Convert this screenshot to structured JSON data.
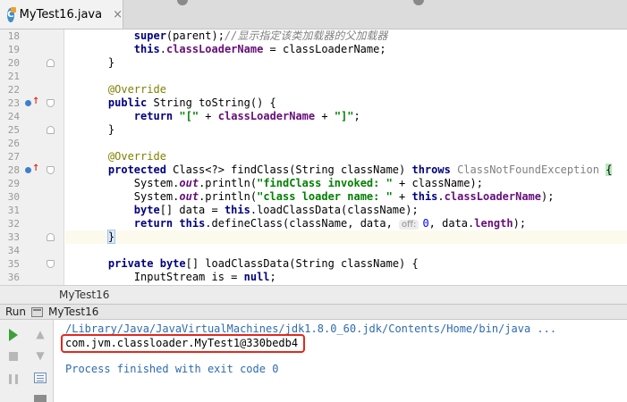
{
  "tab": {
    "icon_letter": "C",
    "file_name": "MyTest16.java",
    "close_glyph": "×"
  },
  "gutter": {
    "line_numbers": [
      "18",
      "19",
      "20",
      "21",
      "22",
      "23",
      "24",
      "25",
      "26",
      "27",
      "28",
      "29",
      "30",
      "31",
      "32",
      "33",
      "34",
      "35",
      "36"
    ]
  },
  "code": {
    "l18": {
      "kw": "super",
      "text": "(parent);",
      "comment": "//显示指定该类加载器的父加载器"
    },
    "l19": {
      "kw": "this",
      "dot": ".",
      "field": "classLoaderName",
      "text": " = classLoaderName;"
    },
    "l20": {
      "text": "}"
    },
    "l22": {
      "annotation": "@Override"
    },
    "l23": {
      "kw": "public",
      "text": " String toString() {"
    },
    "l24": {
      "kw": "return",
      "str1": "\"[\"",
      "op1": " + ",
      "field": "classLoaderName",
      "op2": " + ",
      "str2": "\"]\"",
      "end": ";"
    },
    "l25": {
      "text": "}"
    },
    "l27": {
      "annotation": "@Override"
    },
    "l28": {
      "kw1": "protected",
      "text1": " Class<?> findClass(String className) ",
      "kw2": "throws",
      "exc": " ClassNotFoundException",
      "brace": "{"
    },
    "l29": {
      "pre": "System.",
      "sfield": "out",
      "mid": ".println(",
      "str": "\"findClass invoked: \"",
      "end": " + className);"
    },
    "l30": {
      "pre": "System.",
      "sfield": "out",
      "mid": ".println(",
      "str": "\"class loader name: \"",
      "op": " + ",
      "kw": "this",
      "dot": ".",
      "field": "classLoaderName",
      "end": ");"
    },
    "l31": {
      "kw1": "byte",
      "mid": "[] data = ",
      "kw2": "this",
      "end": ".loadClassData(className);"
    },
    "l32": {
      "kw1": "return",
      "sp": " ",
      "kw2": "this",
      "mid": ".defineClass(className, data, ",
      "hint": "off:",
      "num": "0",
      "sep": ", data.",
      "field": "length",
      "end": ");"
    },
    "l33": {
      "brace": "}"
    },
    "l35": {
      "kw1": "private",
      "sp": " ",
      "kw2": "byte",
      "text": "[] loadClassData(String className) {"
    },
    "l36": {
      "pre": "InputStream is = ",
      "kw": "null",
      "end": ";"
    }
  },
  "breadcrumb": {
    "label": "MyTest16"
  },
  "run": {
    "label": "Run",
    "config": "MyTest16"
  },
  "console": {
    "command": "/Library/Java/JavaVirtualMachines/jdk1.8.0_60.jdk/Contents/Home/bin/java ...",
    "output": "com.jvm.classloader.MyTest1@330bedb4",
    "exit": "Process finished with exit code 0"
  },
  "icons": {
    "up": "▲",
    "down": "▼",
    "override_arrow": "↑"
  },
  "colors": {
    "keyword": "#000080",
    "string": "#008000",
    "field": "#660e7a",
    "annotation": "#808000",
    "console_system": "#2e6bb0",
    "highlight_border": "#e0291f",
    "run_green": "#3ba13b"
  }
}
